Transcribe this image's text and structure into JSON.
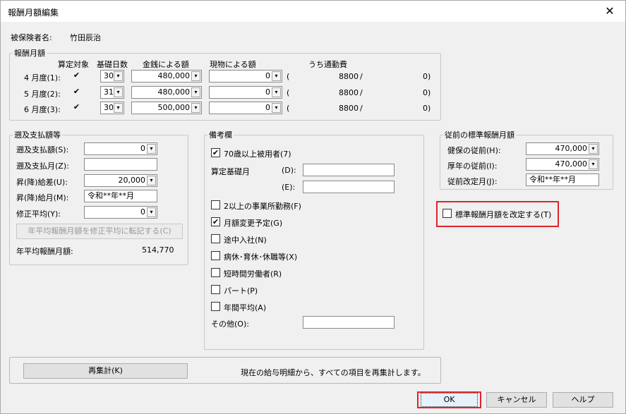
{
  "window": {
    "title": "報酬月額編集",
    "close_symbol": "✕"
  },
  "insured": {
    "label": "被保険者名:",
    "name": "竹田辰治"
  },
  "monthly": {
    "legend": "報酬月額",
    "headers": {
      "target": "算定対象",
      "base_days": "基礎日数",
      "money": "金銭による額",
      "goods": "現物による額",
      "commute": "うち通勤費"
    },
    "rows": [
      {
        "label": "4 月度(1):",
        "checked": "✔",
        "days": "30",
        "money": "480,000",
        "goods": "0",
        "paren": "(",
        "commute": "8800",
        "slash": "/",
        "commute2": "0)"
      },
      {
        "label": "5 月度(2):",
        "checked": "✔",
        "days": "31",
        "money": "480,000",
        "goods": "0",
        "paren": "(",
        "commute": "8800",
        "slash": "/",
        "commute2": "0)"
      },
      {
        "label": "6 月度(3):",
        "checked": "✔",
        "days": "30",
        "money": "500,000",
        "goods": "0",
        "paren": "(",
        "commute": "8800",
        "slash": "/",
        "commute2": "0)"
      }
    ]
  },
  "retro": {
    "legend": "遡及支払額等",
    "amount_label": "遡及支払額(S):",
    "amount_value": "0",
    "month_label": "遡及支払月(Z):",
    "month_value": "",
    "diff_label": "昇(降)給差(U):",
    "diff_value": "20,000",
    "raise_month_label": "昇(降)給月(M):",
    "raise_month_value": "令和**年**月",
    "fix_avg_label": "修正平均(Y):",
    "fix_avg_value": "0",
    "transfer_button": "年平均報酬月額を修正平均に転記する(C)",
    "annual_avg_label": "年平均報酬月額:",
    "annual_avg_value": "514,770"
  },
  "remarks": {
    "legend": "備考欄",
    "over70": {
      "label": "70歳以上被用者(7)",
      "checked": "✔"
    },
    "base_days_label": "算定基礎月",
    "d_label": "(D):",
    "d_value": "",
    "e_label": "(E):",
    "e_value": "",
    "items": [
      {
        "label": "2以上の事業所勤務(F)",
        "checked": ""
      },
      {
        "label": "月額変更予定(G)",
        "checked": "✔"
      },
      {
        "label": "途中入社(N)",
        "checked": ""
      },
      {
        "label": "病休･育休･休職等(X)",
        "checked": ""
      },
      {
        "label": "短時間労働者(R)",
        "checked": ""
      },
      {
        "label": "パート(P)",
        "checked": ""
      },
      {
        "label": "年間平均(A)",
        "checked": ""
      }
    ],
    "other_label": "その他(O):",
    "other_value": ""
  },
  "previous": {
    "legend": "従前の標準報酬月額",
    "health_label": "健保の従前(H):",
    "health_value": "470,000",
    "pension_label": "厚年の従前(I):",
    "pension_value": "470,000",
    "revision_label": "従前改定月(J):",
    "revision_value": "令和**年**月"
  },
  "revise_standard": {
    "label": "標準報酬月額を改定する(T)",
    "checked": ""
  },
  "recalc": {
    "button": "再集計(K)",
    "description": "現在の給与明細から、すべての項目を再集計します。"
  },
  "footer": {
    "ok": "OK",
    "cancel": "キャンセル",
    "help": "ヘルプ"
  },
  "icons": {
    "dropdown": "▾"
  },
  "colors": {
    "highlight": "#e0242c"
  }
}
